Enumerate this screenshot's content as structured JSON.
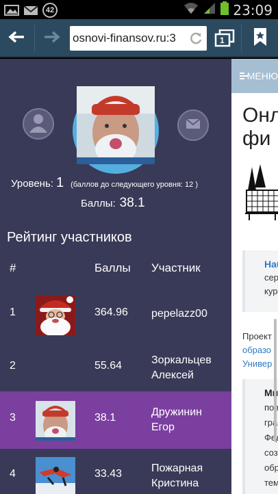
{
  "status_bar": {
    "notification_count": "42",
    "time": "23:09",
    "icons": [
      "image-notification-icon",
      "mail-notification-icon",
      "wifi-icon",
      "signal-icon",
      "battery-icon"
    ]
  },
  "browser": {
    "url": "osnovi-finansov.ru:3",
    "tab_count": "1",
    "icons": [
      "back-arrow-icon",
      "forward-arrow-icon",
      "reload-icon",
      "tabs-icon",
      "bookmark-icon"
    ]
  },
  "profile": {
    "level_label": "Уровень:",
    "level_value": "1",
    "level_hint": "(баллов до следующего уровня: 12 )",
    "points_label": "Баллы:",
    "points_value": "38.1",
    "icons": [
      "user-icon",
      "mail-icon"
    ]
  },
  "rating": {
    "title": "Рейтинг участников",
    "columns": [
      "#",
      "Баллы",
      "Участник"
    ],
    "rows": [
      {
        "rank": "1",
        "score": "364.96",
        "name": "pepelazz00",
        "has_photo": true,
        "photo": "santa"
      },
      {
        "rank": "2",
        "score": "55.64",
        "name": "Зоркальцев Алексей",
        "has_photo": false
      },
      {
        "rank": "3",
        "score": "38.1",
        "name": "Дружинин Егор",
        "has_photo": true,
        "photo": "man",
        "highlighted": true
      },
      {
        "rank": "4",
        "score": "33.43",
        "name": "Пожарная Кристина",
        "has_photo": true,
        "photo": "skydiver"
      }
    ]
  },
  "right_page": {
    "menu_label": "МЕНЮ",
    "title_line1": "Онл",
    "title_line2": "фи",
    "quote1_strong": "Наб",
    "quote1_lines": [
      "сер",
      "кур"
    ],
    "project_lines": [
      "Проект",
      "образо",
      "Универ"
    ],
    "quote2_strong": "Ми",
    "quote2_lines": [
      "пов",
      "гра",
      "Фед",
      "соз",
      "обр",
      "тем"
    ]
  },
  "colors": {
    "panel_bg": "#393a57",
    "highlight_row": "#7b3fa0",
    "browser_bar": "#2b4a60",
    "avatar_ring": "#55aee0",
    "link": "#2f7ac4"
  }
}
